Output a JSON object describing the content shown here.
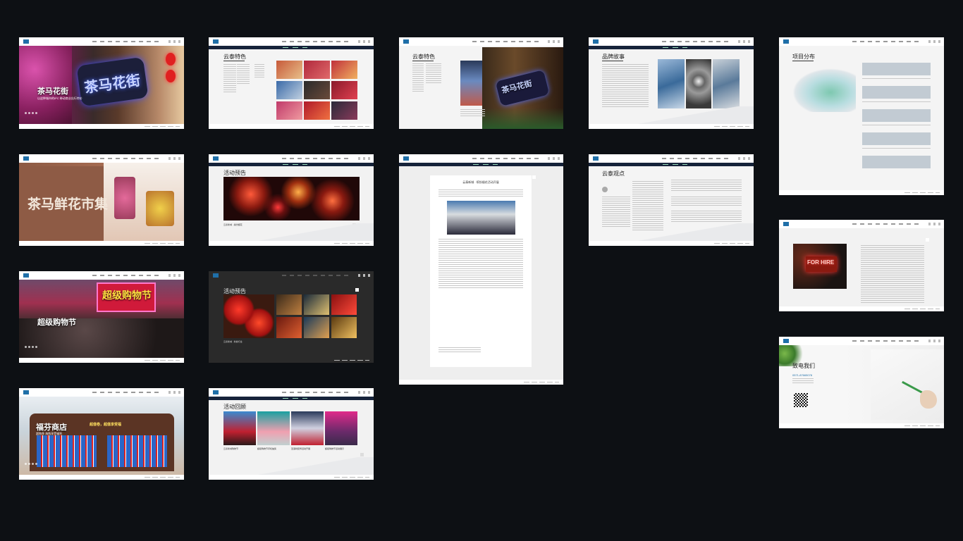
{
  "canvas": {
    "background": "#0d1014"
  },
  "colors": {
    "brand_blue": "#1f6fa8",
    "navy": "#16233a",
    "light_gray": "#f2f2f2"
  },
  "screens": {
    "s1": {
      "title": "茶马花街",
      "hero_sign": "茶马花街",
      "subtitle": "以这种城市的IPC 带动商业出行特价"
    },
    "s2": {
      "hero_sign": "茶马鲜花市集"
    },
    "s3": {
      "title": "超级购物节",
      "banner": "超级购物节"
    },
    "s4": {
      "title": "福芬商店",
      "subtitle": "超购季 海购享受福利",
      "sign": "超值卷，超值享受福"
    },
    "s5": {
      "title": "云泰特色"
    },
    "s6": {
      "title": "活动预告",
      "caption": "云泰新城 · 缤纷烟花"
    },
    "s7": {
      "title": "活动预告",
      "caption": "云泰新城 · 新春灯会"
    },
    "s8": {
      "title": "活动回顾",
      "captions": [
        "云泰新城购物节",
        "超级购物节手机抽奖",
        "圣诞树装饰活动开展",
        "超级购物节活动展示"
      ]
    },
    "s9": {
      "title": "云泰特色",
      "sign": "茶马花街"
    },
    "s10": {
      "title": "云泰新城 · 缤纷烟花活动开展"
    },
    "s11": {
      "title": "品牌故事"
    },
    "s12": {
      "title": "云泰观点"
    },
    "s13": {
      "title": "项目分布"
    },
    "s14": {
      "title": "FOR HIRE"
    },
    "s15": {
      "title": "致电我们",
      "phone": "0571-87665078"
    }
  }
}
